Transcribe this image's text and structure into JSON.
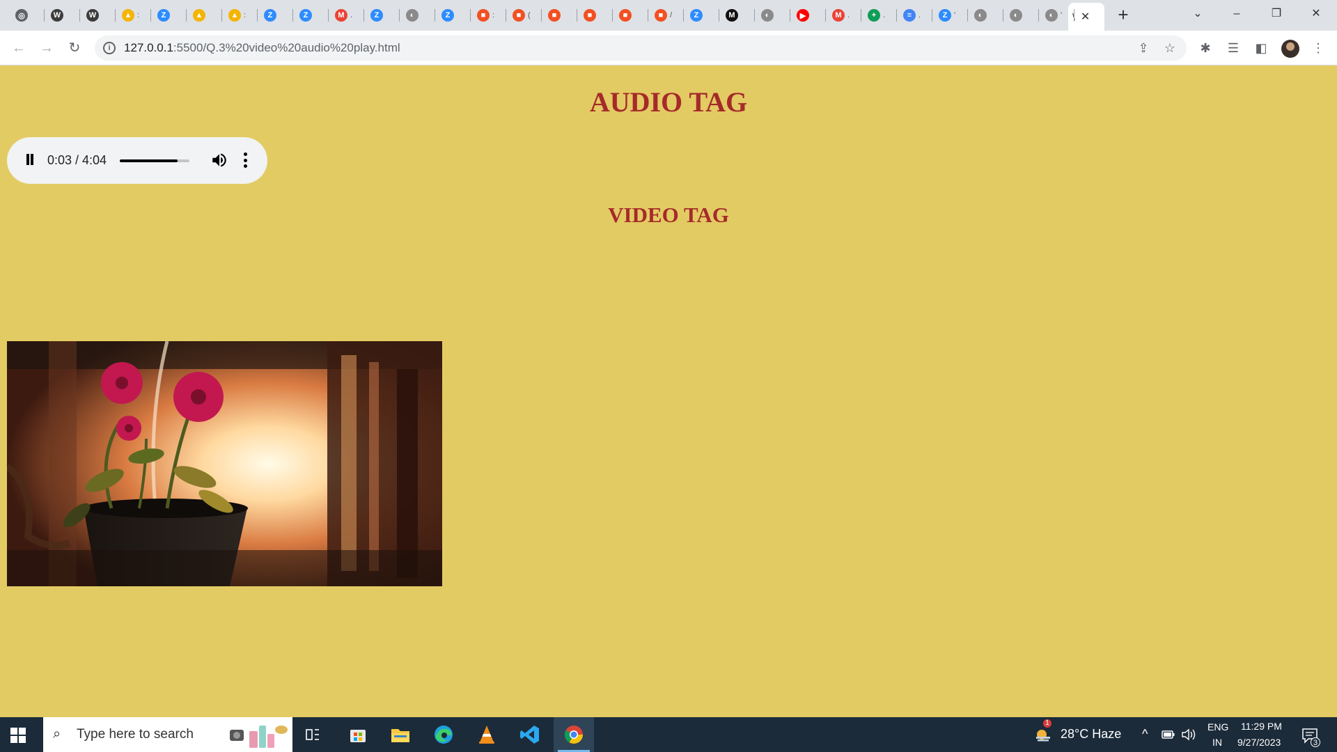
{
  "browser": {
    "tab_title_fragment": "\\",
    "close_tab_glyph": "✕",
    "new_tab_glyph": "+",
    "tab_menu_glyph": "⌄",
    "minimize_glyph": "–",
    "restore_glyph": "❐",
    "close_window_glyph": "✕",
    "url_host": "127.0.0.1",
    "url_rest": ":5500/Q.3%20video%20audio%20play.html",
    "back_glyph": "←",
    "forward_glyph": "→",
    "reload_glyph": "↻",
    "info_glyph": "i",
    "share_glyph": "⇪",
    "star_glyph": "☆",
    "extensions_glyph": "✱",
    "media_glyph": "☰",
    "sidepanel_glyph": "◧",
    "kebab_glyph": "⋮",
    "mini_tabs": [
      {
        "icon": "chrome-icon",
        "color": "#5f6368",
        "glyph": "◎",
        "tail": ""
      },
      {
        "icon": "wordpress-icon",
        "color": "#3c3c3c",
        "glyph": "W",
        "tail": ""
      },
      {
        "icon": "wordpress-icon",
        "color": "#3c3c3c",
        "glyph": "W",
        "tail": ""
      },
      {
        "icon": "google-drive-icon",
        "color": "#f4b400",
        "glyph": "▲",
        "tail": ":"
      },
      {
        "icon": "zoom-icon",
        "color": "#2d8cff",
        "glyph": "Z",
        "tail": ""
      },
      {
        "icon": "google-drive-icon",
        "color": "#f4b400",
        "glyph": "▲",
        "tail": ""
      },
      {
        "icon": "google-drive-icon",
        "color": "#f4b400",
        "glyph": "▲",
        "tail": ":"
      },
      {
        "icon": "zoom-icon",
        "color": "#2d8cff",
        "glyph": "Z",
        "tail": ""
      },
      {
        "icon": "zoom-icon",
        "color": "#2d8cff",
        "glyph": "Z",
        "tail": ""
      },
      {
        "icon": "gmail-icon",
        "color": "#ea4335",
        "glyph": "M",
        "tail": "."
      },
      {
        "icon": "zoom-icon",
        "color": "#2d8cff",
        "glyph": "Z",
        "tail": ""
      },
      {
        "icon": "globe-icon",
        "color": "#8a8a8a",
        "glyph": "◐",
        "tail": ""
      },
      {
        "icon": "zoom-icon",
        "color": "#2d8cff",
        "glyph": "Z",
        "tail": ""
      },
      {
        "icon": "microsoft-icon",
        "color": "#f25022",
        "glyph": "■",
        "tail": ":"
      },
      {
        "icon": "microsoft-icon",
        "color": "#f25022",
        "glyph": "■",
        "tail": "("
      },
      {
        "icon": "microsoft-icon",
        "color": "#f25022",
        "glyph": "■",
        "tail": ""
      },
      {
        "icon": "microsoft-icon",
        "color": "#f25022",
        "glyph": "■",
        "tail": ""
      },
      {
        "icon": "microsoft-icon",
        "color": "#f25022",
        "glyph": "■",
        "tail": ""
      },
      {
        "icon": "microsoft-icon",
        "color": "#f25022",
        "glyph": "■",
        "tail": "/"
      },
      {
        "icon": "zoom-icon",
        "color": "#2d8cff",
        "glyph": "Z",
        "tail": ""
      },
      {
        "icon": "medium-icon",
        "color": "#111111",
        "glyph": "M",
        "tail": ""
      },
      {
        "icon": "globe-icon",
        "color": "#8a8a8a",
        "glyph": "◐",
        "tail": ""
      },
      {
        "icon": "youtube-icon",
        "color": "#ff0000",
        "glyph": "▶",
        "tail": ""
      },
      {
        "icon": "gmail-icon",
        "color": "#ea4335",
        "glyph": "M",
        "tail": "."
      },
      {
        "icon": "sheets-icon",
        "color": "#0f9d58",
        "glyph": "+",
        "tail": "."
      },
      {
        "icon": "docs-icon",
        "color": "#4285f4",
        "glyph": "≡",
        "tail": "."
      },
      {
        "icon": "zoom-icon",
        "color": "#2d8cff",
        "glyph": "Z",
        "tail": "'"
      },
      {
        "icon": "globe-icon",
        "color": "#8a8a8a",
        "glyph": "◐",
        "tail": ""
      },
      {
        "icon": "globe-icon",
        "color": "#8a8a8a",
        "glyph": "◐",
        "tail": ""
      },
      {
        "icon": "globe-icon",
        "color": "#8a8a8a",
        "glyph": "◐",
        "tail": "'"
      }
    ]
  },
  "page": {
    "background": "#e3cb63",
    "heading_color": "#a52a2a",
    "audio_heading": "AUDIO TAG",
    "video_heading": "VIDEO TAG",
    "audio_player": {
      "current_time": "0:03",
      "duration": "4:04",
      "time_display": "0:03 / 4:04",
      "volume_fraction": 0.83,
      "playing": true
    },
    "video": {
      "subject": "red dahlia flowers in a pot, backlit by sunset"
    }
  },
  "taskbar": {
    "search_placeholder": "Type here to search",
    "search_glyph": "⌕",
    "weather_text": "28°C  Haze",
    "weather_badge": "1",
    "tray_chevron": "^",
    "language_line1": "ENG",
    "language_line2": "IN",
    "time": "11:29 PM",
    "date": "9/27/2023",
    "notification_count": "3",
    "apps": [
      "task-view",
      "microsoft-store",
      "file-explorer",
      "edge",
      "vlc",
      "vscode",
      "chrome"
    ]
  }
}
